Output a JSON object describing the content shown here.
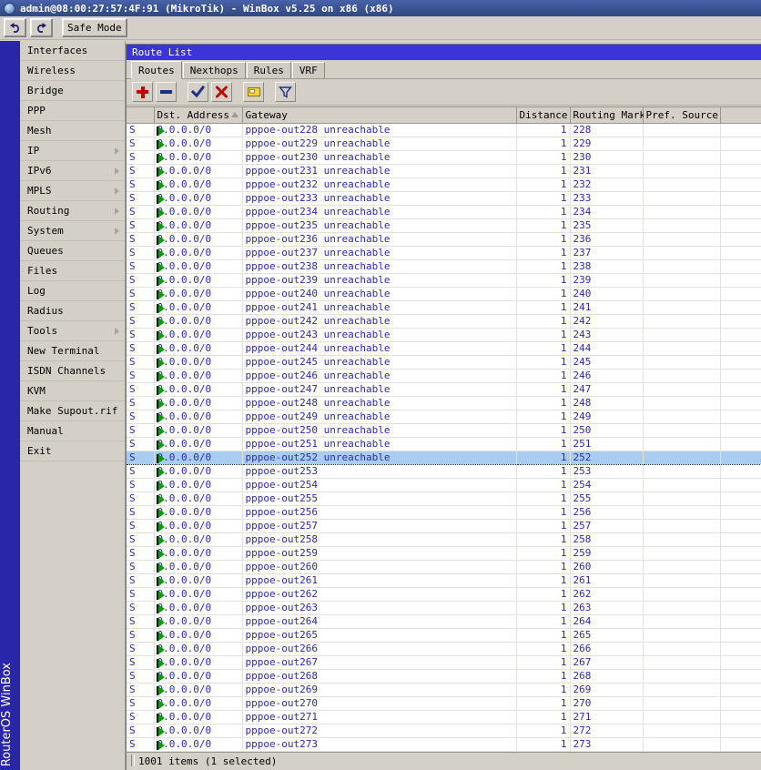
{
  "window_title": "admin@08:00:27:57:4F:91 (MikroTik) - WinBox v5.25 on x86 (x86)",
  "brand": "RouterOS WinBox",
  "toolbar": {
    "undo_icon": "undo-icon",
    "redo_icon": "redo-icon",
    "safe_mode_label": "Safe Mode"
  },
  "sidebar": {
    "items": [
      {
        "label": "Interfaces",
        "submenu": false
      },
      {
        "label": "Wireless",
        "submenu": false
      },
      {
        "label": "Bridge",
        "submenu": false
      },
      {
        "label": "PPP",
        "submenu": false
      },
      {
        "label": "Mesh",
        "submenu": false
      },
      {
        "label": "IP",
        "submenu": true
      },
      {
        "label": "IPv6",
        "submenu": true
      },
      {
        "label": "MPLS",
        "submenu": true
      },
      {
        "label": "Routing",
        "submenu": true
      },
      {
        "label": "System",
        "submenu": true
      },
      {
        "label": "Queues",
        "submenu": false
      },
      {
        "label": "Files",
        "submenu": false
      },
      {
        "label": "Log",
        "submenu": false
      },
      {
        "label": "Radius",
        "submenu": false
      },
      {
        "label": "Tools",
        "submenu": true
      },
      {
        "label": "New Terminal",
        "submenu": false
      },
      {
        "label": "ISDN Channels",
        "submenu": false
      },
      {
        "label": "KVM",
        "submenu": false
      },
      {
        "label": "Make Supout.rif",
        "submenu": false
      },
      {
        "label": "Manual",
        "submenu": false
      },
      {
        "label": "Exit",
        "submenu": false
      }
    ]
  },
  "route_window": {
    "title": "Route List",
    "tabs": [
      {
        "label": "Routes",
        "active": true
      },
      {
        "label": "Nexthops",
        "active": false
      },
      {
        "label": "Rules",
        "active": false
      },
      {
        "label": "VRF",
        "active": false
      }
    ],
    "actions": [
      {
        "name": "add-route-button",
        "icon": "plus-icon"
      },
      {
        "name": "remove-route-button",
        "icon": "minus-icon"
      },
      {
        "name": "enable-route-button",
        "icon": "check-icon"
      },
      {
        "name": "disable-route-button",
        "icon": "cross-icon"
      },
      {
        "name": "comment-button",
        "icon": "note-icon"
      },
      {
        "name": "filter-button",
        "icon": "funnel-icon"
      }
    ],
    "columns": [
      {
        "label": "",
        "key": "flag"
      },
      {
        "label": "Dst. Address",
        "key": "dst",
        "sorted": true
      },
      {
        "label": "Gateway",
        "key": "gateway"
      },
      {
        "label": "Distance",
        "key": "distance"
      },
      {
        "label": "Routing Mark",
        "key": "routing_mark"
      },
      {
        "label": "Pref. Source",
        "key": "pref_source"
      },
      {
        "label": "",
        "key": "spacer"
      }
    ],
    "rows": [
      {
        "flag": "S",
        "dst": "0.0.0.0/0",
        "gateway": "pppoe-out228 unreachable",
        "distance": "1",
        "routing_mark": "228",
        "pref_source": "",
        "selected": false
      },
      {
        "flag": "S",
        "dst": "0.0.0.0/0",
        "gateway": "pppoe-out229 unreachable",
        "distance": "1",
        "routing_mark": "229",
        "pref_source": "",
        "selected": false
      },
      {
        "flag": "S",
        "dst": "0.0.0.0/0",
        "gateway": "pppoe-out230 unreachable",
        "distance": "1",
        "routing_mark": "230",
        "pref_source": "",
        "selected": false
      },
      {
        "flag": "S",
        "dst": "0.0.0.0/0",
        "gateway": "pppoe-out231 unreachable",
        "distance": "1",
        "routing_mark": "231",
        "pref_source": "",
        "selected": false
      },
      {
        "flag": "S",
        "dst": "0.0.0.0/0",
        "gateway": "pppoe-out232 unreachable",
        "distance": "1",
        "routing_mark": "232",
        "pref_source": "",
        "selected": false
      },
      {
        "flag": "S",
        "dst": "0.0.0.0/0",
        "gateway": "pppoe-out233 unreachable",
        "distance": "1",
        "routing_mark": "233",
        "pref_source": "",
        "selected": false
      },
      {
        "flag": "S",
        "dst": "0.0.0.0/0",
        "gateway": "pppoe-out234 unreachable",
        "distance": "1",
        "routing_mark": "234",
        "pref_source": "",
        "selected": false
      },
      {
        "flag": "S",
        "dst": "0.0.0.0/0",
        "gateway": "pppoe-out235 unreachable",
        "distance": "1",
        "routing_mark": "235",
        "pref_source": "",
        "selected": false
      },
      {
        "flag": "S",
        "dst": "0.0.0.0/0",
        "gateway": "pppoe-out236 unreachable",
        "distance": "1",
        "routing_mark": "236",
        "pref_source": "",
        "selected": false
      },
      {
        "flag": "S",
        "dst": "0.0.0.0/0",
        "gateway": "pppoe-out237 unreachable",
        "distance": "1",
        "routing_mark": "237",
        "pref_source": "",
        "selected": false
      },
      {
        "flag": "S",
        "dst": "0.0.0.0/0",
        "gateway": "pppoe-out238 unreachable",
        "distance": "1",
        "routing_mark": "238",
        "pref_source": "",
        "selected": false
      },
      {
        "flag": "S",
        "dst": "0.0.0.0/0",
        "gateway": "pppoe-out239 unreachable",
        "distance": "1",
        "routing_mark": "239",
        "pref_source": "",
        "selected": false
      },
      {
        "flag": "S",
        "dst": "0.0.0.0/0",
        "gateway": "pppoe-out240 unreachable",
        "distance": "1",
        "routing_mark": "240",
        "pref_source": "",
        "selected": false
      },
      {
        "flag": "S",
        "dst": "0.0.0.0/0",
        "gateway": "pppoe-out241 unreachable",
        "distance": "1",
        "routing_mark": "241",
        "pref_source": "",
        "selected": false
      },
      {
        "flag": "S",
        "dst": "0.0.0.0/0",
        "gateway": "pppoe-out242 unreachable",
        "distance": "1",
        "routing_mark": "242",
        "pref_source": "",
        "selected": false
      },
      {
        "flag": "S",
        "dst": "0.0.0.0/0",
        "gateway": "pppoe-out243 unreachable",
        "distance": "1",
        "routing_mark": "243",
        "pref_source": "",
        "selected": false
      },
      {
        "flag": "S",
        "dst": "0.0.0.0/0",
        "gateway": "pppoe-out244 unreachable",
        "distance": "1",
        "routing_mark": "244",
        "pref_source": "",
        "selected": false
      },
      {
        "flag": "S",
        "dst": "0.0.0.0/0",
        "gateway": "pppoe-out245 unreachable",
        "distance": "1",
        "routing_mark": "245",
        "pref_source": "",
        "selected": false
      },
      {
        "flag": "S",
        "dst": "0.0.0.0/0",
        "gateway": "pppoe-out246 unreachable",
        "distance": "1",
        "routing_mark": "246",
        "pref_source": "",
        "selected": false
      },
      {
        "flag": "S",
        "dst": "0.0.0.0/0",
        "gateway": "pppoe-out247 unreachable",
        "distance": "1",
        "routing_mark": "247",
        "pref_source": "",
        "selected": false
      },
      {
        "flag": "S",
        "dst": "0.0.0.0/0",
        "gateway": "pppoe-out248 unreachable",
        "distance": "1",
        "routing_mark": "248",
        "pref_source": "",
        "selected": false
      },
      {
        "flag": "S",
        "dst": "0.0.0.0/0",
        "gateway": "pppoe-out249 unreachable",
        "distance": "1",
        "routing_mark": "249",
        "pref_source": "",
        "selected": false
      },
      {
        "flag": "S",
        "dst": "0.0.0.0/0",
        "gateway": "pppoe-out250 unreachable",
        "distance": "1",
        "routing_mark": "250",
        "pref_source": "",
        "selected": false
      },
      {
        "flag": "S",
        "dst": "0.0.0.0/0",
        "gateway": "pppoe-out251 unreachable",
        "distance": "1",
        "routing_mark": "251",
        "pref_source": "",
        "selected": false
      },
      {
        "flag": "S",
        "dst": "0.0.0.0/0",
        "gateway": "pppoe-out252 unreachable",
        "distance": "1",
        "routing_mark": "252",
        "pref_source": "",
        "selected": true
      },
      {
        "flag": "S",
        "dst": "0.0.0.0/0",
        "gateway": "pppoe-out253",
        "distance": "1",
        "routing_mark": "253",
        "pref_source": "",
        "selected": false
      },
      {
        "flag": "S",
        "dst": "0.0.0.0/0",
        "gateway": "pppoe-out254",
        "distance": "1",
        "routing_mark": "254",
        "pref_source": "",
        "selected": false
      },
      {
        "flag": "S",
        "dst": "0.0.0.0/0",
        "gateway": "pppoe-out255",
        "distance": "1",
        "routing_mark": "255",
        "pref_source": "",
        "selected": false
      },
      {
        "flag": "S",
        "dst": "0.0.0.0/0",
        "gateway": "pppoe-out256",
        "distance": "1",
        "routing_mark": "256",
        "pref_source": "",
        "selected": false
      },
      {
        "flag": "S",
        "dst": "0.0.0.0/0",
        "gateway": "pppoe-out257",
        "distance": "1",
        "routing_mark": "257",
        "pref_source": "",
        "selected": false
      },
      {
        "flag": "S",
        "dst": "0.0.0.0/0",
        "gateway": "pppoe-out258",
        "distance": "1",
        "routing_mark": "258",
        "pref_source": "",
        "selected": false
      },
      {
        "flag": "S",
        "dst": "0.0.0.0/0",
        "gateway": "pppoe-out259",
        "distance": "1",
        "routing_mark": "259",
        "pref_source": "",
        "selected": false
      },
      {
        "flag": "S",
        "dst": "0.0.0.0/0",
        "gateway": "pppoe-out260",
        "distance": "1",
        "routing_mark": "260",
        "pref_source": "",
        "selected": false
      },
      {
        "flag": "S",
        "dst": "0.0.0.0/0",
        "gateway": "pppoe-out261",
        "distance": "1",
        "routing_mark": "261",
        "pref_source": "",
        "selected": false
      },
      {
        "flag": "S",
        "dst": "0.0.0.0/0",
        "gateway": "pppoe-out262",
        "distance": "1",
        "routing_mark": "262",
        "pref_source": "",
        "selected": false
      },
      {
        "flag": "S",
        "dst": "0.0.0.0/0",
        "gateway": "pppoe-out263",
        "distance": "1",
        "routing_mark": "263",
        "pref_source": "",
        "selected": false
      },
      {
        "flag": "S",
        "dst": "0.0.0.0/0",
        "gateway": "pppoe-out264",
        "distance": "1",
        "routing_mark": "264",
        "pref_source": "",
        "selected": false
      },
      {
        "flag": "S",
        "dst": "0.0.0.0/0",
        "gateway": "pppoe-out265",
        "distance": "1",
        "routing_mark": "265",
        "pref_source": "",
        "selected": false
      },
      {
        "flag": "S",
        "dst": "0.0.0.0/0",
        "gateway": "pppoe-out266",
        "distance": "1",
        "routing_mark": "266",
        "pref_source": "",
        "selected": false
      },
      {
        "flag": "S",
        "dst": "0.0.0.0/0",
        "gateway": "pppoe-out267",
        "distance": "1",
        "routing_mark": "267",
        "pref_source": "",
        "selected": false
      },
      {
        "flag": "S",
        "dst": "0.0.0.0/0",
        "gateway": "pppoe-out268",
        "distance": "1",
        "routing_mark": "268",
        "pref_source": "",
        "selected": false
      },
      {
        "flag": "S",
        "dst": "0.0.0.0/0",
        "gateway": "pppoe-out269",
        "distance": "1",
        "routing_mark": "269",
        "pref_source": "",
        "selected": false
      },
      {
        "flag": "S",
        "dst": "0.0.0.0/0",
        "gateway": "pppoe-out270",
        "distance": "1",
        "routing_mark": "270",
        "pref_source": "",
        "selected": false
      },
      {
        "flag": "S",
        "dst": "0.0.0.0/0",
        "gateway": "pppoe-out271",
        "distance": "1",
        "routing_mark": "271",
        "pref_source": "",
        "selected": false
      },
      {
        "flag": "S",
        "dst": "0.0.0.0/0",
        "gateway": "pppoe-out272",
        "distance": "1",
        "routing_mark": "272",
        "pref_source": "",
        "selected": false
      },
      {
        "flag": "S",
        "dst": "0.0.0.0/0",
        "gateway": "pppoe-out273",
        "distance": "1",
        "routing_mark": "273",
        "pref_source": "",
        "selected": false
      }
    ],
    "status": "1001 items (1 selected)"
  },
  "colors": {
    "titlebar": "#3c5596",
    "window_title": "#3c34d8",
    "brand_strip": "#2a26aa",
    "chrome": "#d4d0c8",
    "row_text": "#2b2bb0",
    "selection": "#a8cdf0",
    "route_icon": "#0a9a0a"
  }
}
